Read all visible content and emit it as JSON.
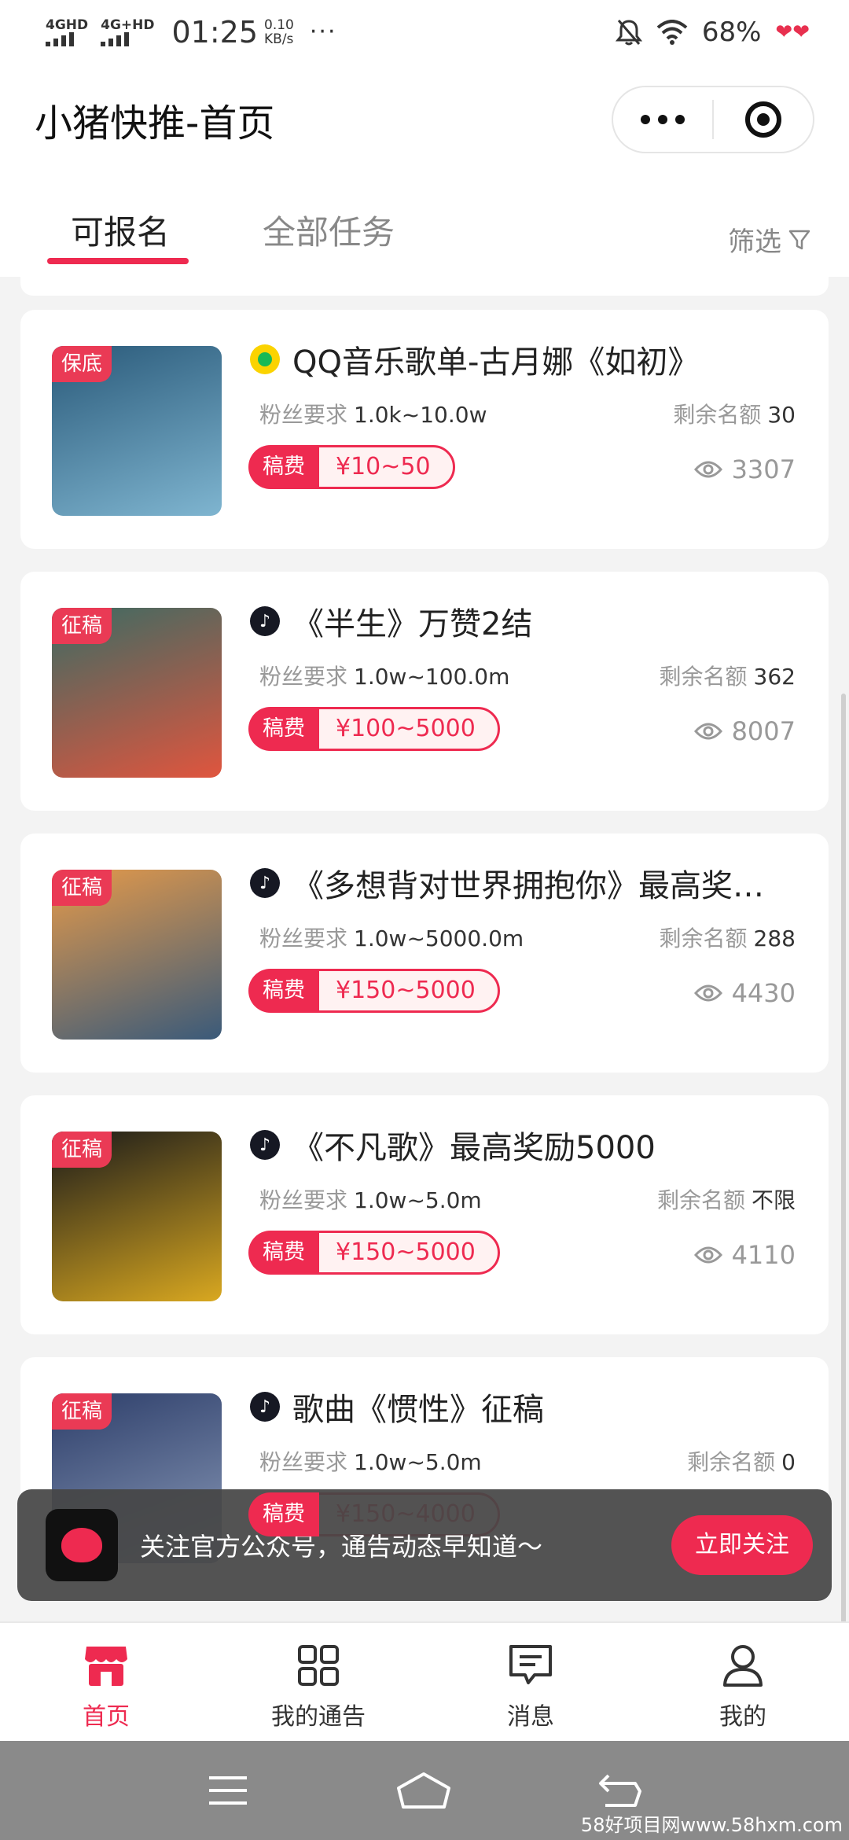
{
  "status_bar": {
    "net1": "4GHD",
    "net2": "4G+HD",
    "time": "01:25",
    "speed_value": "0.10",
    "speed_unit": "KB/s",
    "more": "···",
    "battery": "68%"
  },
  "header": {
    "title": "小猪快推-首页"
  },
  "tabs": {
    "active": "可报名",
    "all": "全部任务",
    "filter": "筛选"
  },
  "labels": {
    "fans_req": "粉丝要求",
    "quota": "剩余名额",
    "fee": "稿费"
  },
  "tasks": [
    {
      "tag": "保底",
      "platform": "qq-music",
      "title": "QQ音乐歌单-古月娜《如初》",
      "fans": "1.0k~10.0w",
      "quota": "30",
      "fee": "¥10~50",
      "views": "3307",
      "cover_colors": [
        "#2a5a7a",
        "#7fb5d0"
      ]
    },
    {
      "tag": "征稿",
      "platform": "douyin",
      "title": "《半生》万赞2结",
      "fans": "1.0w~100.0m",
      "quota": "362",
      "fee": "¥100~5000",
      "views": "8007",
      "cover_colors": [
        "#3c6b63",
        "#e0553e"
      ]
    },
    {
      "tag": "征稿",
      "platform": "douyin",
      "title": "《多想背对世界拥抱你》最高奖…",
      "fans": "1.0w~5000.0m",
      "quota": "288",
      "fee": "¥150~5000",
      "views": "4430",
      "cover_colors": [
        "#e59a4a",
        "#3a5a7a"
      ]
    },
    {
      "tag": "征稿",
      "platform": "douyin",
      "title": "《不凡歌》最高奖励5000",
      "fans": "1.0w~5.0m",
      "quota": "不限",
      "fee": "¥150~5000",
      "views": "4110",
      "cover_colors": [
        "#1a1a1a",
        "#d9a820"
      ]
    },
    {
      "tag": "征稿",
      "platform": "douyin",
      "title": "歌曲《惯性》征稿",
      "fans": "1.0w~5.0m",
      "quota": "0",
      "fee": "¥150~4000",
      "views": "",
      "cover_colors": [
        "#2d3e6a",
        "#8a9ab8"
      ]
    }
  ],
  "banner": {
    "text": "关注官方公众号，通告动态早知道～",
    "button": "立即关注"
  },
  "bottom_nav": [
    {
      "label": "首页",
      "icon": "shop-icon",
      "active": true
    },
    {
      "label": "我的通告",
      "icon": "grid-icon",
      "active": false
    },
    {
      "label": "消息",
      "icon": "message-icon",
      "active": false
    },
    {
      "label": "我的",
      "icon": "user-icon",
      "active": false
    }
  ],
  "watermark": "58好项目网www.58hxm.com",
  "colors": {
    "accent": "#ee2a50",
    "background": "#f3f3f3"
  }
}
